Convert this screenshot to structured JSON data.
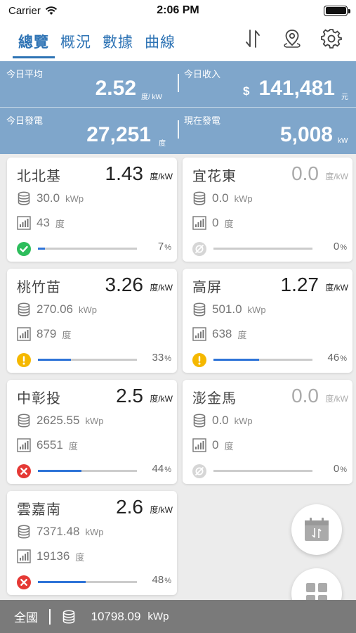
{
  "status_bar": {
    "carrier": "Carrier",
    "time": "2:06 PM"
  },
  "nav": {
    "tabs": [
      {
        "label": "總覽",
        "active": true
      },
      {
        "label": "概況",
        "active": false
      },
      {
        "label": "數據",
        "active": false
      },
      {
        "label": "曲線",
        "active": false
      }
    ],
    "icons": [
      "sort-arrows-icon",
      "map-pin-icon",
      "gear-icon"
    ]
  },
  "summary": {
    "today_avg": {
      "label": "今日平均",
      "value": "2.52",
      "unit": "度/ kW"
    },
    "today_income": {
      "label": "今日收入",
      "currency": "$",
      "value": "141,481",
      "unit": "元"
    },
    "today_gen": {
      "label": "今日發電",
      "value": "27,251",
      "unit": "度"
    },
    "current_gen": {
      "label": "現在發電",
      "value": "5,008",
      "unit": "kW"
    }
  },
  "cards": [
    {
      "name": "北北基",
      "value": "1.43",
      "unit": "度/kW",
      "capacity": "30.0",
      "cap_unit": "kWp",
      "energy": "43",
      "energy_unit": "度",
      "percent": 7,
      "percent_text": "7",
      "status": "ok",
      "status_icon": "check-circle-icon"
    },
    {
      "name": "宜花東",
      "value": "0.0",
      "unit": "度/kW",
      "capacity": "0.0",
      "cap_unit": "kWp",
      "energy": "0",
      "energy_unit": "度",
      "percent": 0,
      "percent_text": "0",
      "status": "offline",
      "status_icon": "offline-icon"
    },
    {
      "name": "桃竹苗",
      "value": "3.26",
      "unit": "度/kW",
      "capacity": "270.06",
      "cap_unit": "kWp",
      "energy": "879",
      "energy_unit": "度",
      "percent": 33,
      "percent_text": "33",
      "status": "warning",
      "status_icon": "warning-circle-icon"
    },
    {
      "name": "高屏",
      "value": "1.27",
      "unit": "度/kW",
      "capacity": "501.0",
      "cap_unit": "kWp",
      "energy": "638",
      "energy_unit": "度",
      "percent": 46,
      "percent_text": "46",
      "status": "warning",
      "status_icon": "warning-circle-icon"
    },
    {
      "name": "中彰投",
      "value": "2.5",
      "unit": "度/kW",
      "capacity": "2625.55",
      "cap_unit": "kWp",
      "energy": "6551",
      "energy_unit": "度",
      "percent": 44,
      "percent_text": "44",
      "status": "error",
      "status_icon": "error-circle-icon"
    },
    {
      "name": "澎金馬",
      "value": "0.0",
      "unit": "度/kW",
      "capacity": "0.0",
      "cap_unit": "kWp",
      "energy": "0",
      "energy_unit": "度",
      "percent": 0,
      "percent_text": "0",
      "status": "offline",
      "status_icon": "offline-icon"
    },
    {
      "name": "雲嘉南",
      "value": "2.6",
      "unit": "度/kW",
      "capacity": "7371.48",
      "cap_unit": "kWp",
      "energy": "19136",
      "energy_unit": "度",
      "percent": 48,
      "percent_text": "48",
      "status": "error",
      "status_icon": "error-circle-icon"
    }
  ],
  "percent_sign": "%",
  "footer": {
    "region": "全國",
    "capacity": "10798.09",
    "cap_unit": "kWp"
  },
  "colors": {
    "accent": "#2f74b5",
    "summary_bg": "#7fa6cb",
    "ok": "#2dbd5c",
    "warning": "#f5b800",
    "error": "#e53935",
    "bar": "#2f74d8",
    "footer_bg": "#7a7a7a"
  },
  "fabs": [
    "calendar-icon",
    "grid-icon"
  ]
}
